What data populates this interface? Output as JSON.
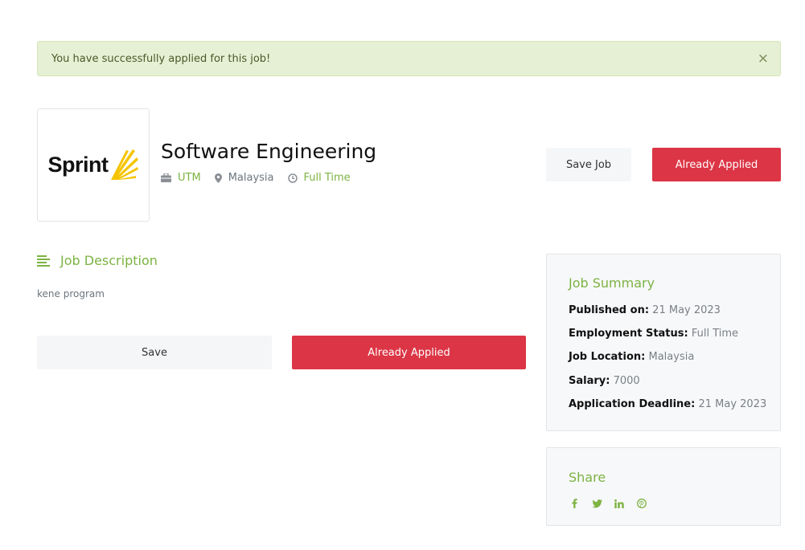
{
  "alert": {
    "message": "You have successfully applied for this job!",
    "close_glyph": "×"
  },
  "company": {
    "logo_text": "Sprint",
    "logo_accent_color": "#f5c400"
  },
  "job": {
    "title": "Software Engineering",
    "company_name": "UTM",
    "location": "Malaysia",
    "type": "Full Time"
  },
  "actions": {
    "save_job_label": "Save Job",
    "applied_label": "Already Applied",
    "save_label": "Save",
    "applied_bottom_label": "Already Applied"
  },
  "description": {
    "heading": "Job Description",
    "text": "kene program"
  },
  "summary": {
    "title": "Job Summary",
    "rows": [
      {
        "label": "Published on:",
        "value": "21 May 2023"
      },
      {
        "label": "Employment Status:",
        "value": "Full Time"
      },
      {
        "label": "Job Location:",
        "value": "Malaysia"
      },
      {
        "label": "Salary:",
        "value": "7000"
      },
      {
        "label": "Application Deadline:",
        "value": "21 May 2023"
      }
    ]
  },
  "share": {
    "title": "Share",
    "icons": [
      "facebook-icon",
      "twitter-icon",
      "linkedin-icon",
      "pinterest-icon"
    ]
  },
  "colors": {
    "accent_green": "#7cb342",
    "danger_red": "#dc3545",
    "alert_bg": "#e6f0d4"
  }
}
